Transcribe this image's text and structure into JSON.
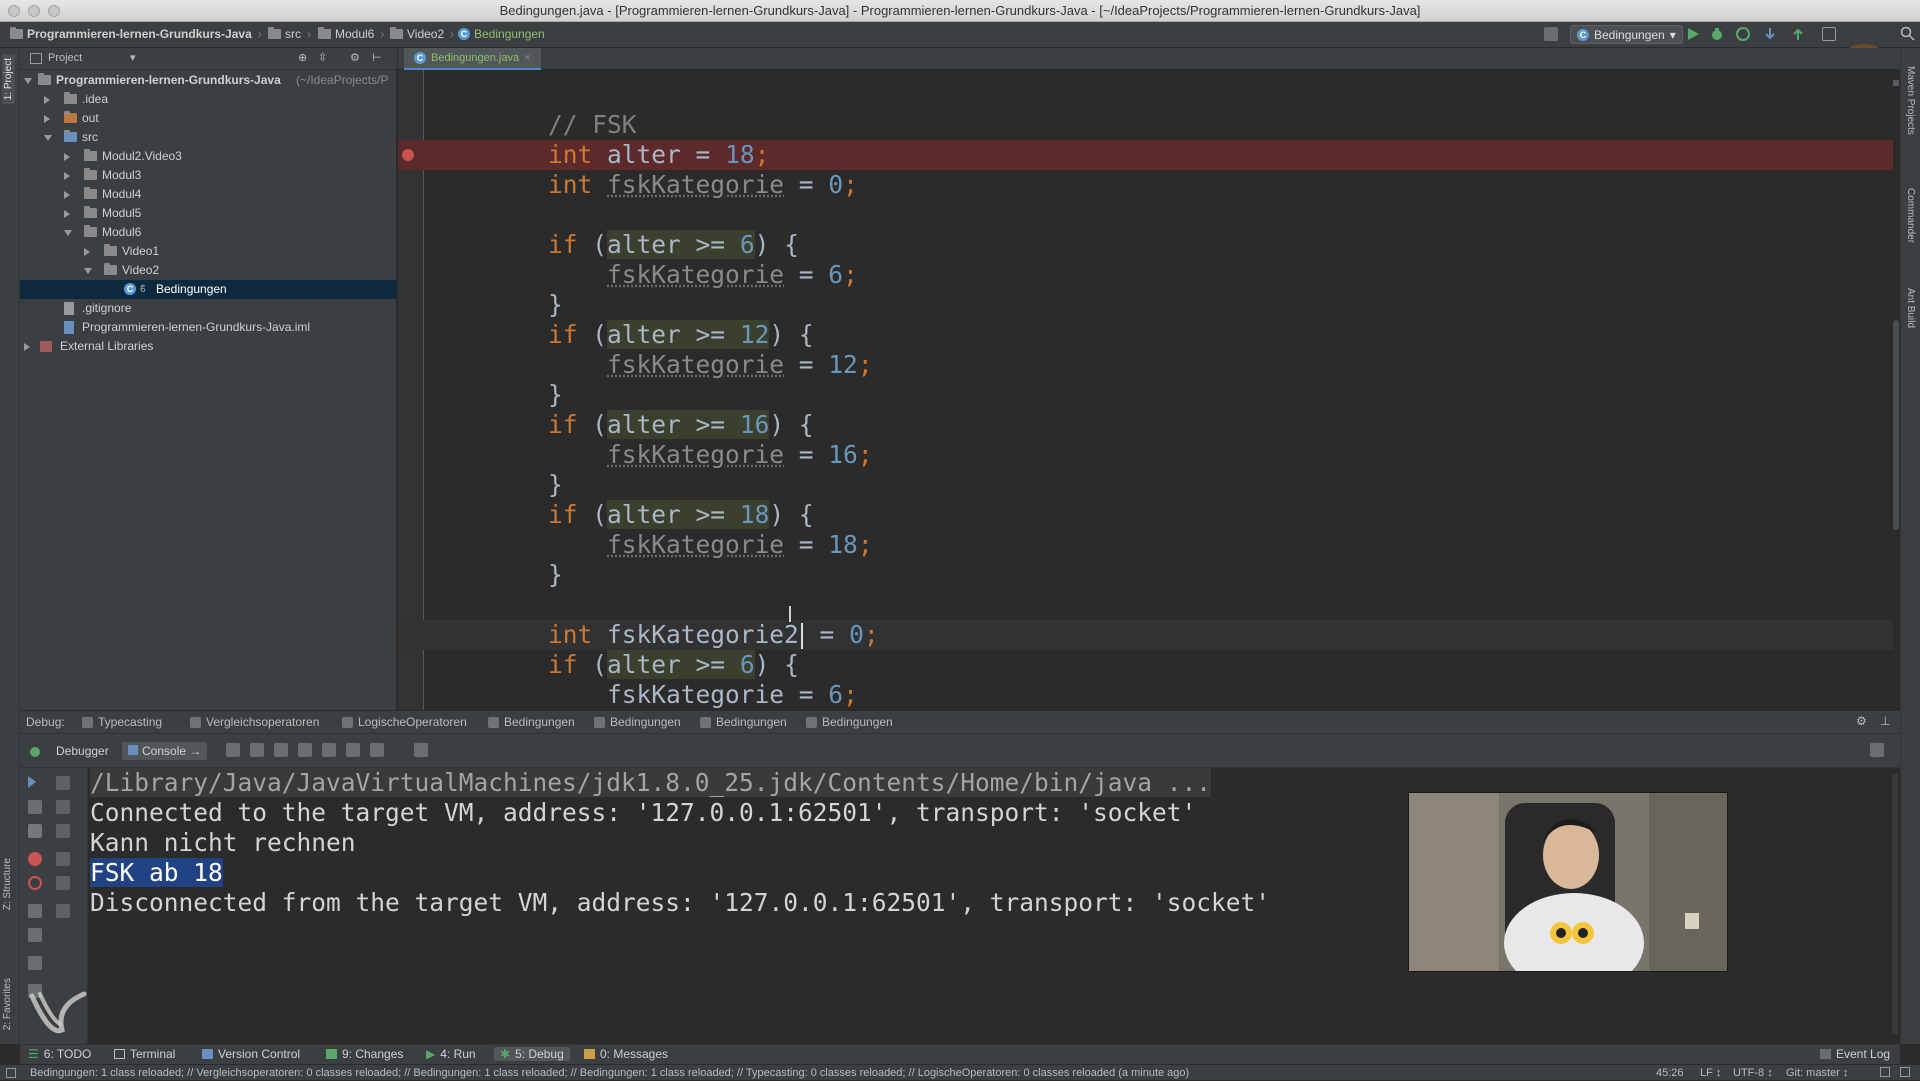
{
  "window": {
    "title": "Bedingungen.java - [Programmieren-lernen-Grundkurs-Java] - Programmieren-lernen-Grundkurs-Java - [~/IdeaProjects/Programmieren-lernen-Grundkurs-Java]"
  },
  "navbar": {
    "crumbs": [
      "Programmieren-lernen-Grundkurs-Java",
      "src",
      "Modul6",
      "Video2",
      "Bedingungen"
    ],
    "run_config": "Bedingungen"
  },
  "left_stripe": {
    "project": "1: Project",
    "structure": "Z: Structure",
    "favorites": "2: Favorites"
  },
  "right_stripe": {
    "maven": "Maven Projects",
    "commander": "Commander",
    "ant": "Ant Build"
  },
  "project_panel": {
    "header": "Project",
    "tree": [
      {
        "label": "Programmieren-lernen-Grundkurs-Java",
        "suffix": "(~/IdeaProjects/P"
      },
      {
        "label": ".idea"
      },
      {
        "label": "out"
      },
      {
        "label": "src"
      },
      {
        "label": "Modul2.Video3"
      },
      {
        "label": "Modul3"
      },
      {
        "label": "Modul4"
      },
      {
        "label": "Modul5"
      },
      {
        "label": "Modul6"
      },
      {
        "label": "Video1"
      },
      {
        "label": "Video2"
      },
      {
        "label": "Bedingungen"
      },
      {
        "label": ".gitignore"
      },
      {
        "label": "Programmieren-lernen-Grundkurs-Java.iml"
      },
      {
        "label": "External Libraries"
      }
    ]
  },
  "editor": {
    "tab": "Bedingungen.java",
    "lines": {
      "comment": "// FSK",
      "kw_int": "int",
      "kw_if": "if",
      "alter": "alter",
      "fsk": "fskKategorie",
      "fsk2": "fskKategorie2",
      "eq": " = ",
      "ge": " >= ",
      "n18": "18",
      "n0": "0",
      "n6": "6",
      "n12": "12",
      "n16": "16",
      "semi": ";",
      "open": " (",
      "close": ") {",
      "brace": "}"
    }
  },
  "debug": {
    "label": "Debug:",
    "tabs": [
      "Typecasting",
      "Vergleichsoperatoren",
      "LogischeOperatoren",
      "Bedingungen",
      "Bedingungen",
      "Bedingungen",
      "Bedingungen"
    ],
    "subtabs": {
      "debugger": "Debugger",
      "console": "Console"
    }
  },
  "console": {
    "lines": [
      "/Library/Java/JavaVirtualMachines/jdk1.8.0_25.jdk/Contents/Home/bin/java ...",
      "Connected to the target VM, address: '127.0.0.1:62501', transport: 'socket'",
      "Kann nicht rechnen",
      "FSK ab 18",
      "Disconnected from the target VM, address: '127.0.0.1:62501', transport: 'socket'"
    ]
  },
  "bottom_tools": {
    "todo": "6: TODO",
    "terminal": "Terminal",
    "vcs": "Version Control",
    "changes": "9: Changes",
    "run": "4: Run",
    "debug": "5: Debug",
    "messages": "0: Messages",
    "event_log": "Event Log"
  },
  "status": {
    "message": "Bedingungen: 1 class reloaded; // Vergleichsoperatoren: 0 classes reloaded; // Bedingungen: 1 class reloaded; // Bedingungen: 1 class reloaded; // Typecasting: 0 classes reloaded; // LogischeOperatoren: 0 classes reloaded (a minute ago)",
    "position": "45:26",
    "line_sep": "LF ↕",
    "encoding": "UTF-8 ↕",
    "git": "Git: master ↕"
  },
  "colors": {
    "keyword": "#cc7832",
    "number": "#6897bb",
    "comment": "#808080",
    "breakpoint": "#c75450",
    "selection": "#214283"
  }
}
